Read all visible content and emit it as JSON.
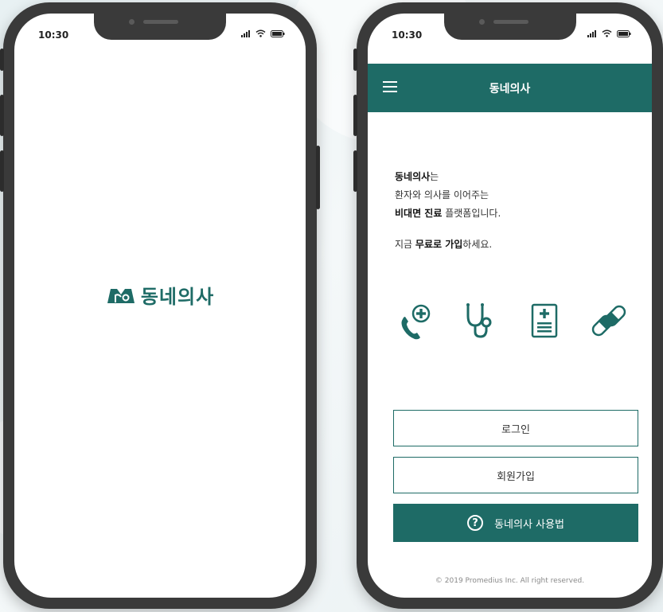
{
  "colors": {
    "brand": "#1e6b66",
    "phone_frame": "#3a3a3a",
    "background": "#e8f1f3"
  },
  "status_bar": {
    "time": "10:30"
  },
  "splash": {
    "logo_text": "동네의사",
    "logo_icon": "brand-logo-icon"
  },
  "app": {
    "title": "동네의사",
    "intro": {
      "line1_bold": "동네의사",
      "line1_rest": "는",
      "line2": "환자와 의사를 이어주는",
      "line3_bold": "비대면 진료",
      "line3_rest": " 플랫폼입니다.",
      "line4_pre": "지금 ",
      "line4_bold": "무료로 가입",
      "line4_rest": "하세요."
    },
    "feature_icons": [
      "phone-call-plus-icon",
      "stethoscope-icon",
      "medical-document-icon",
      "pills-icon"
    ],
    "buttons": {
      "login": "로그인",
      "signup": "회원가입",
      "guide": "동네의사 사용법",
      "guide_glyph": "?"
    },
    "copyright": "© 2019 Promedius Inc. All right reserved."
  }
}
